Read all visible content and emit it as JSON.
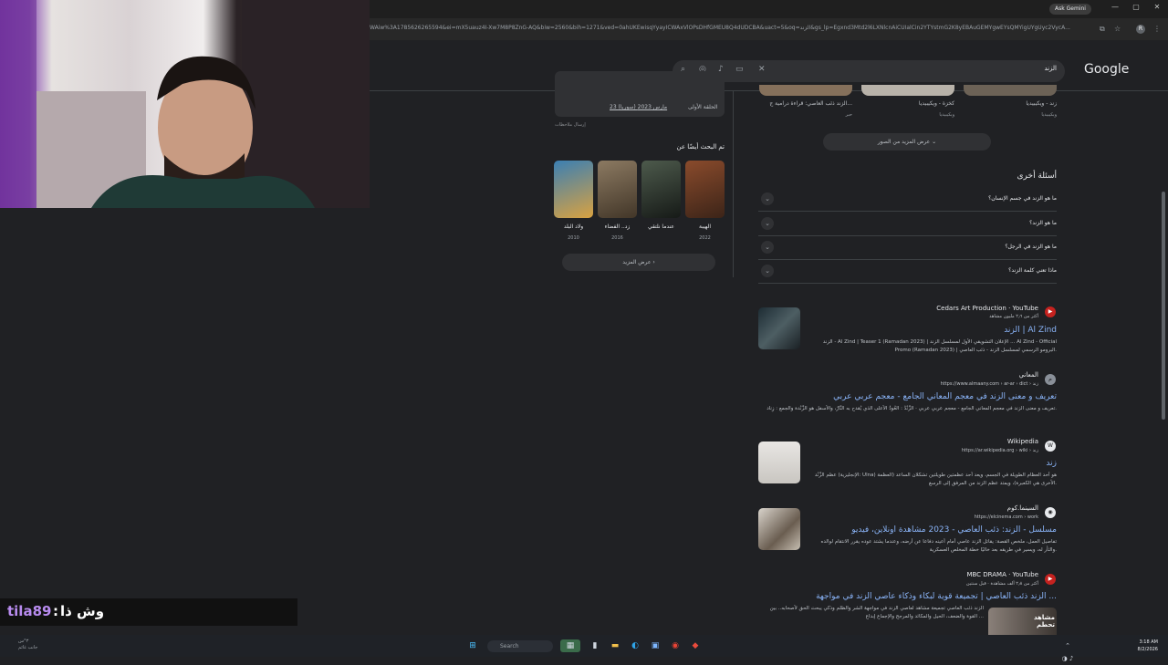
{
  "browser": {
    "address": "WAiw%3A1785626265594&ei=mX5uauz4I-Xw7M8P8ZnG-AQ&biw=2560&bih=1271&ved=0ahUKEwisqYyayICWAxVlOPsDHfGMEU8Q4dUDCBA&uact=5&oq=الزند&gs_lp=Egxnd3Mtd2l6LXNlcnAiCUاalCin2YTYstmG2K8yEBAuGEMYgwEYsQMYigUYgUyc2VycA...",
    "ask_gemini": "Ask Gemini",
    "window_controls": [
      "—",
      "▢",
      "✕"
    ]
  },
  "search": {
    "query": "الزند",
    "logo": "Google"
  },
  "left_panel": {
    "episode_label": "الحلقة الأولى",
    "episode_date": "23 مارس 2023 (سوريا)",
    "feedback": "إرسال ملاحظات",
    "also_searched_title": "تم البحث أيضًا عن",
    "posters": [
      {
        "name": "الهيبة",
        "year": "2022",
        "colors": [
          "#8a4b2c",
          "#3c2418"
        ]
      },
      {
        "name": "عندما نلتقي",
        "year": "",
        "colors": [
          "#4d5a4c",
          "#161a17"
        ]
      },
      {
        "name": "زد.. الفضاء",
        "year": "2016",
        "colors": [
          "#8c7a62",
          "#423628"
        ]
      },
      {
        "name": "ولاد البلد",
        "year": "2010",
        "colors": [
          "#3b7fb3",
          "#d9a241"
        ]
      }
    ],
    "show_more": "عرض المزيد"
  },
  "images_row": {
    "captions": [
      {
        "title": "زند - ويكيبيديا",
        "source": "ويكيبيديا"
      },
      {
        "title": "كخزة - ويكيبيديا",
        "source": "ويكيبيديا"
      },
      {
        "title": "الزند ذئب العاصي: قراءة درامية ج...",
        "source": "حبر"
      }
    ],
    "more_images": "عرض المزيد من الصور"
  },
  "paa": {
    "title": "أسئلة أخرى",
    "questions": [
      "ما هو الزند في جسم الإنسان؟",
      "ما هو الزند؟",
      "ما هو الزند في الرجل؟",
      "ماذا تعني كلمة الزند؟"
    ]
  },
  "results": [
    {
      "site": "Cedars Art Production · YouTube",
      "url": "أكثر من ٢٫٦ مليون مشاهد",
      "title": "الزند | Al Zind",
      "snippet": "الزند - Al Zind | Teaser 1 (Ramadan 2023) | الإعلان التشويقي الأول لمسلسل الزند ... Al Zind - Official Promo (Ramadan 2023) | البرومو الرسمي لمسلسل الزند - ذئب العاصي."
    },
    {
      "site": "المعاني",
      "url": "https://www.almaany.com › ar-ar › dict › زند",
      "title": "تعريف و معنى الزند في معجم المعاني الجامع - معجم عربي عربي",
      "snippet": "تعريف و معنى الزند في معجم المعاني الجامع - معجم عربي عربي · الزَّنْدُ : العُودُ الأعلى الذي يُقدح به النَّارُ، والأسفل هو الزَّنْدة والجمع : زِناد."
    },
    {
      "site": "Wikipedia",
      "url": "https://ar.wikipedia.org › wiki › زند",
      "title": "زند",
      "snippet": "عظم الزَّنْد (الإنجليزية: Ulna) هو أحد العظام الطويلة في الجسم، ويعد أحد عظمتين طويلتين تشكلان الساعد (العظمة الأخرى هي الكعبرة)، ويمتد عظم الزند من المرفق إلى الرسغ."
    },
    {
      "site": "السينما.كوم",
      "url": "https://elcinema.com › work",
      "title": "مسلسل - الزند: ذئب العاصي - 2023 مشاهدة اونلاين، فيديو",
      "snippet": "تفاصيل العمل، ملخص القصة: يقاتل الزند عاصي أمام أعينه دفاعا عن أرضه، وعندما يشتد عوده يقرر الانتقام لوالده والثأر له، ويسير في طريقه بعد خاليًا خطة المخلص العسكرية."
    },
    {
      "site": "MBC DRAMA · YouTube",
      "url": "أكثر من ٢٫٨ ألف مشاهدة · قبل سنتين",
      "title": "الزند ذئب العاصي | تجميعة قوية لبكاء وذكاء عاصي الزند في مواجهة ...",
      "snippet": "الزند ذئب العاصي تجميعة مشاهد لعاصي الزند في مواجهة الشر والظلم وذكي يبحث الحق لأصحابه.. بين القوة والضعف، الحيل والمكائد والمرجح والإجماع إبداع ..."
    }
  ],
  "video_thumb_badge": "مشاهد تحطم",
  "chat": {
    "user": "tila89",
    "separator": ":",
    "message": "وش ذا"
  },
  "taskbar": {
    "weather": [
      "٣°س",
      "جانب غائم"
    ],
    "search_label": "Search",
    "time": "3:18 AM",
    "date": "8/2/2026"
  }
}
